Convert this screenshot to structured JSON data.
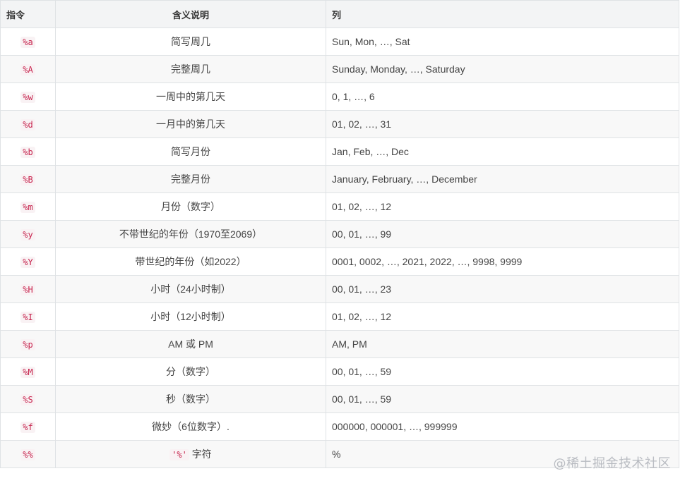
{
  "table": {
    "headers": [
      "指令",
      "含义说明",
      "列"
    ],
    "rows": [
      {
        "directive": "%a",
        "meaning": "简写周几",
        "example": "Sun, Mon, …, Sat"
      },
      {
        "directive": "%A",
        "meaning": "完整周几",
        "example": "Sunday, Monday, …, Saturday"
      },
      {
        "directive": "%w",
        "meaning": "一周中的第几天",
        "example": "0, 1, …, 6"
      },
      {
        "directive": "%d",
        "meaning": "一月中的第几天",
        "example": "01, 02, …, 31"
      },
      {
        "directive": "%b",
        "meaning": "简写月份",
        "example": "Jan, Feb, …, Dec"
      },
      {
        "directive": "%B",
        "meaning": "完整月份",
        "example": "January, February, …, December"
      },
      {
        "directive": "%m",
        "meaning": "月份（数字）",
        "example": "01, 02, …, 12"
      },
      {
        "directive": "%y",
        "meaning": "不带世纪的年份（1970至2069）",
        "example": "00, 01, …, 99"
      },
      {
        "directive": "%Y",
        "meaning": "带世纪的年份（如2022）",
        "example": "0001, 0002, …, 2021, 2022, …, 9998, 9999"
      },
      {
        "directive": "%H",
        "meaning": "小时（24小时制）",
        "example": "00, 01, …, 23"
      },
      {
        "directive": "%I",
        "meaning": "小时（12小时制）",
        "example": "01, 02, …, 12"
      },
      {
        "directive": "%p",
        "meaning": "AM 或 PM",
        "example": "AM, PM"
      },
      {
        "directive": "%M",
        "meaning": "分（数字）",
        "example": "00, 01, …, 59"
      },
      {
        "directive": "%S",
        "meaning": "秒（数字）",
        "example": "00, 01, …, 59"
      },
      {
        "directive": "%f",
        "meaning": "微妙（6位数字）.",
        "example": "000000, 000001, …, 999999"
      },
      {
        "directive": "%%",
        "meaning_code": "'%'",
        "meaning_suffix": " 字符",
        "example": "%"
      }
    ]
  },
  "watermark": "@稀土掘金技术社区"
}
